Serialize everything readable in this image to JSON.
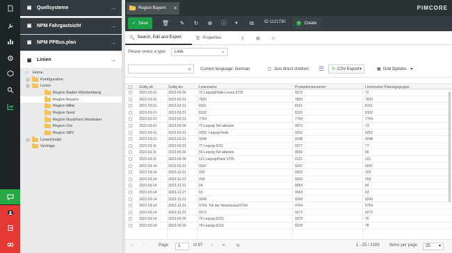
{
  "sidebar": {
    "panels": [
      "Quellsysteme",
      "NPM Fahrgastsicht",
      "NPM PPBus.plan",
      "Linien"
    ],
    "tree": {
      "home": "Home",
      "konfiguration": "Konfiguration",
      "linien": "Linien",
      "regions": [
        "Region Baden Württemberg",
        "Region Bayern",
        "Region Mitte",
        "Region Nord",
        "Region Nordrhein Westfalen",
        "Region Ost",
        "Region SBV"
      ],
      "linienondbl": "LinienOndbl",
      "vertrage": "Verträge"
    }
  },
  "tab": {
    "title": "Region Bayern"
  },
  "brand": "PIMCORE",
  "toolbar": {
    "save": "Save",
    "id": "ID 1121730",
    "create": "Create"
  },
  "subtabs": {
    "search": "Search, Edit and Export",
    "properties": "Properties"
  },
  "filter": {
    "label": "Please select a type",
    "value": "Linie"
  },
  "search": {
    "language": "Current language: German",
    "direct_children": "Just direct children",
    "csv_export": "CSV Export",
    "grid_options": "Grid Options"
  },
  "grid": {
    "headers": [
      "Gültig ab",
      "Gültig bis",
      "Linienname",
      "Produktionsnummer",
      "Linienname Planungsgruppe"
    ],
    "rows": [
      [
        "2022-03-01",
        "2023-06-30",
        "72 Leipzig/Halle-Leuna 9725",
        "0372",
        "72"
      ],
      [
        "2022-03-01",
        "2023-03-31",
        "7820",
        "7820",
        "7820"
      ],
      [
        "2022-03-01",
        "2023-03-31",
        "8101",
        "8101",
        "8101"
      ],
      [
        "2022-03-01",
        "2023-03-31",
        "8102",
        "8102",
        "8102"
      ],
      [
        "2022-03-01",
        "2023-03-31",
        "7764",
        "7764",
        "7764"
      ],
      [
        "2022-03-01",
        "2023-06-30",
        "73 Leipzig Tell abwärts",
        "0073",
        "73"
      ],
      [
        "2022-03-01",
        "2023-03-31",
        "9252, Leipzig-Halle",
        "9252",
        "9252"
      ],
      [
        "2022-03-01",
        "2023-03-31",
        "9248",
        "9248",
        "9248"
      ],
      [
        "2022-03-11",
        "2023-03-31",
        "77 Leipzig-9211",
        "0377",
        "77"
      ],
      [
        "2022-03-11",
        "2023-06-30",
        "56 Leipzig Tell abwärts",
        "0056",
        "56"
      ],
      [
        "2022-03-11",
        "2023-06-30",
        "121 Leipzig/Halle 9725",
        "0121",
        "121"
      ],
      [
        "2022-03-14",
        "2023-03-31",
        "9247",
        "9247",
        "9247"
      ],
      [
        "2022-03-14",
        "2023-12-31",
        "202",
        "0202",
        "202"
      ],
      [
        "2022-03-14",
        "2023-12-31",
        "203",
        "0203",
        "203"
      ],
      [
        "2022-03-14",
        "2023-12-31",
        "64",
        "0064",
        "64"
      ],
      [
        "2022-03-14",
        "2023-12-27",
        "63",
        "0063",
        "63"
      ],
      [
        "2022-03-14",
        "2023-12-31",
        "9249",
        "9249",
        "9249"
      ],
      [
        "2022-03-14",
        "2023-12-31",
        "9764, Tell der Reisebusse/9764",
        "9764",
        "9764"
      ],
      [
        "2022-03-14",
        "2023-12-31",
        "9272",
        "9272",
        "9272"
      ],
      [
        "2022-03-14",
        "2023-06-30",
        "76 Leipzig-9213",
        "0376",
        "76"
      ],
      [
        "2022-03-14",
        "2023-06-30",
        "78 Leipzig-9213",
        "0378",
        "78"
      ]
    ]
  },
  "pager": {
    "page_label": "Page",
    "page": "1",
    "of": "of 87",
    "summary": "1 - 25 / 2165",
    "per_page_label": "Items per page",
    "per_page": "25"
  }
}
